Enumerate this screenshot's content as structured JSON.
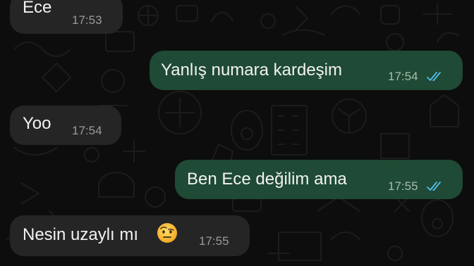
{
  "messages": [
    {
      "direction": "incoming",
      "text": "Ece",
      "time": "17:53"
    },
    {
      "direction": "outgoing",
      "text": "Yanlış numara kardeşim",
      "time": "17:54",
      "status": "read"
    },
    {
      "direction": "incoming",
      "text": "Yoo",
      "time": "17:54"
    },
    {
      "direction": "outgoing",
      "text": "Ben Ece değilim ama",
      "time": "17:55",
      "status": "read"
    },
    {
      "direction": "incoming",
      "text": "Nesin uzaylı mı",
      "emoji": "face-with-raised-eyebrow",
      "time": "17:55"
    }
  ],
  "colors": {
    "background": "#0d0d0d",
    "incoming_bubble": "#252525",
    "outgoing_bubble": "#1f4a35",
    "read_ticks": "#53bdeb"
  },
  "icons": {
    "read_receipt": "double-check-icon",
    "emoji": "face-with-raised-eyebrow-emoji"
  }
}
